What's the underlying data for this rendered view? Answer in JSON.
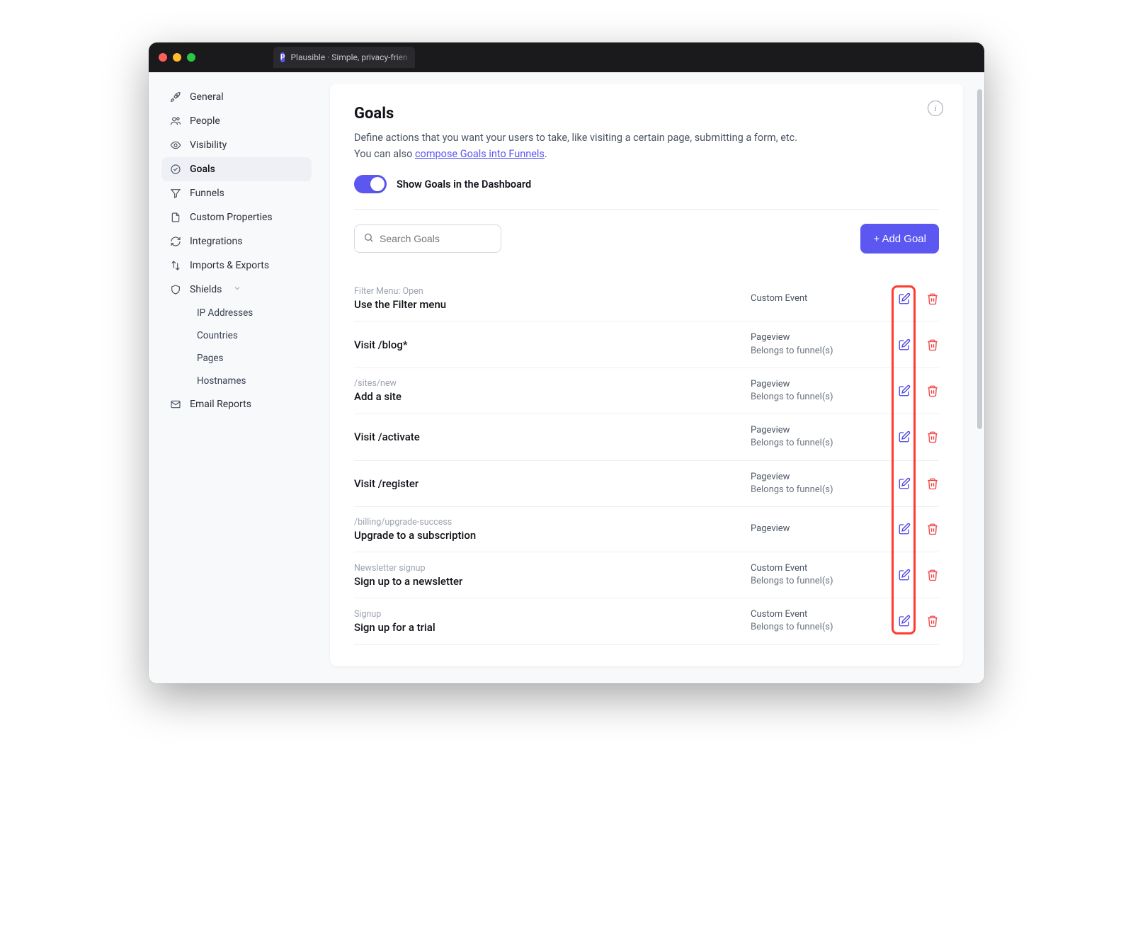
{
  "browser": {
    "tab_title": "Plausible · Simple, privacy-frien"
  },
  "sidebar": {
    "items": [
      {
        "label": "General"
      },
      {
        "label": "People"
      },
      {
        "label": "Visibility"
      },
      {
        "label": "Goals"
      },
      {
        "label": "Funnels"
      },
      {
        "label": "Custom Properties"
      },
      {
        "label": "Integrations"
      },
      {
        "label": "Imports & Exports"
      },
      {
        "label": "Shields"
      },
      {
        "label": "Email Reports"
      }
    ],
    "shields_children": [
      {
        "label": "IP Addresses"
      },
      {
        "label": "Countries"
      },
      {
        "label": "Pages"
      },
      {
        "label": "Hostnames"
      }
    ]
  },
  "page": {
    "title": "Goals",
    "desc_line1": "Define actions that you want your users to take, like visiting a certain page, submitting a form, etc.",
    "desc_line2_prefix": "You can also ",
    "desc_link": "compose Goals into Funnels",
    "desc_line2_suffix": ".",
    "toggle_label": "Show Goals in the Dashboard",
    "search_placeholder": "Search Goals",
    "add_button": "+ Add Goal"
  },
  "goals": [
    {
      "sub": "Filter Menu: Open",
      "title": "Use the Filter menu",
      "type": "Custom Event",
      "belongs": ""
    },
    {
      "sub": "",
      "title": "Visit /blog*",
      "type": "Pageview",
      "belongs": "Belongs to funnel(s)"
    },
    {
      "sub": "/sites/new",
      "title": "Add a site",
      "type": "Pageview",
      "belongs": "Belongs to funnel(s)"
    },
    {
      "sub": "",
      "title": "Visit /activate",
      "type": "Pageview",
      "belongs": "Belongs to funnel(s)"
    },
    {
      "sub": "",
      "title": "Visit /register",
      "type": "Pageview",
      "belongs": "Belongs to funnel(s)"
    },
    {
      "sub": "/billing/upgrade-success",
      "title": "Upgrade to a subscription",
      "type": "Pageview",
      "belongs": ""
    },
    {
      "sub": "Newsletter signup",
      "title": "Sign up to a newsletter",
      "type": "Custom Event",
      "belongs": "Belongs to funnel(s)"
    },
    {
      "sub": "Signup",
      "title": "Sign up for a trial",
      "type": "Custom Event",
      "belongs": "Belongs to funnel(s)"
    }
  ]
}
